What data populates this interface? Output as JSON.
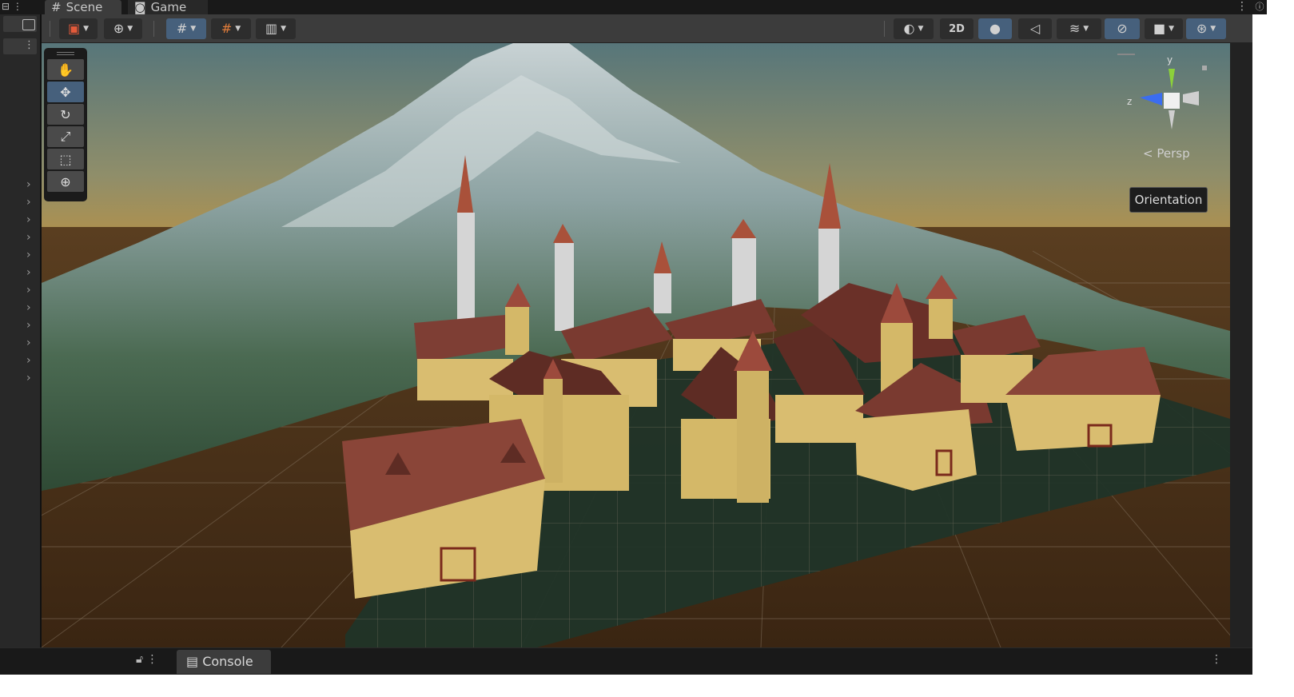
{
  "tabs": [
    {
      "label": "Scene",
      "icon": "hash-icon"
    },
    {
      "label": "Game",
      "icon": "gamepad-icon"
    }
  ],
  "toolbar": {
    "view_toggle_2d": "2D",
    "left_buttons": [
      "gizmo-toggle",
      "global-local",
      "grid-snap",
      "increment-snap",
      "grid-visibility"
    ],
    "right_buttons": [
      "shading-mode",
      "2d",
      "lighting",
      "audio",
      "effects",
      "hidden-objects",
      "camera",
      "gizmos"
    ]
  },
  "tools": [
    "hand",
    "move",
    "rotate",
    "scale",
    "rect",
    "transform"
  ],
  "active_tool": "move",
  "gizmo": {
    "y_label": "y",
    "z_label": "z",
    "projection": "Persp",
    "tooltip": "Orientation",
    "colors": {
      "y": "#8cd13a",
      "z": "#3b6df0"
    }
  },
  "bottom": {
    "console_label": "Console"
  },
  "colors": {
    "toolbar_bg": "#3c3c3c",
    "active_blue": "#46607c"
  }
}
